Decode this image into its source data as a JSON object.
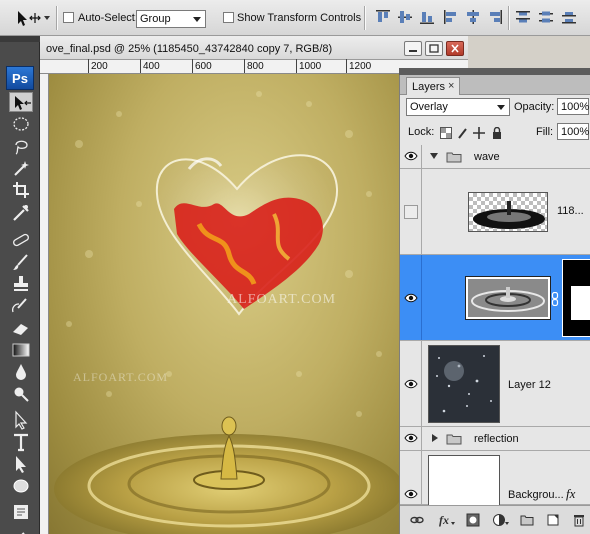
{
  "options_bar": {
    "auto_select_label": "Auto-Select:",
    "auto_select_value": "Group",
    "show_transform_label": "Show Transform Controls",
    "tool_icon": "move-tool-icon",
    "align_icons": [
      "align-top-icon",
      "align-vcenter-icon",
      "align-bottom-icon",
      "align-left-icon",
      "align-hcenter-icon",
      "align-right-icon",
      "distribute-top-icon",
      "distribute-vcenter-icon",
      "distribute-bottom-icon"
    ]
  },
  "tools": {
    "logo": "Ps",
    "items": [
      "move-tool",
      "marquee-tool",
      "lasso-tool",
      "magic-wand-tool",
      "crop-tool",
      "eyedropper-tool",
      "healing-brush-tool",
      "brush-tool",
      "clone-stamp-tool",
      "history-brush-tool",
      "eraser-tool",
      "gradient-tool",
      "blur-tool",
      "dodge-tool",
      "pen-tool",
      "type-tool",
      "path-selection-tool",
      "ellipse-tool",
      "notes-tool",
      "eyedropper-small-tool"
    ]
  },
  "document": {
    "title": "ove_final.psd @ 25% (1185450_43742840 copy 7, RGB/8)",
    "ruler_labels": [
      "200",
      "400",
      "600",
      "800",
      "1000",
      "1200"
    ],
    "watermark_main": "ALFOART.COM",
    "watermark_side": "ALFOART.COM"
  },
  "layers_panel": {
    "tab_label": "Layers",
    "tab_close": "×",
    "blend_mode": "Overlay",
    "opacity_label": "Opacity:",
    "opacity_value": "100%",
    "lock_label": "Lock:",
    "fill_label": "Fill:",
    "fill_value": "100%",
    "layers": [
      {
        "name": "wave",
        "kind": "group",
        "visible": true
      },
      {
        "name": "118...",
        "kind": "layer",
        "visible": false
      },
      {
        "name": "",
        "kind": "masked-layer",
        "visible": true,
        "selected": true
      },
      {
        "name": "Layer 12",
        "kind": "layer",
        "visible": true
      },
      {
        "name": "reflection",
        "kind": "group",
        "visible": true
      },
      {
        "name": "Backgrou...",
        "kind": "layer",
        "visible": true,
        "fx": "fx"
      }
    ],
    "footer_icons": [
      "link-layers-icon",
      "fx-icon",
      "add-mask-icon",
      "adjustment-layer-icon",
      "new-group-icon",
      "new-layer-icon",
      "delete-layer-icon"
    ]
  }
}
